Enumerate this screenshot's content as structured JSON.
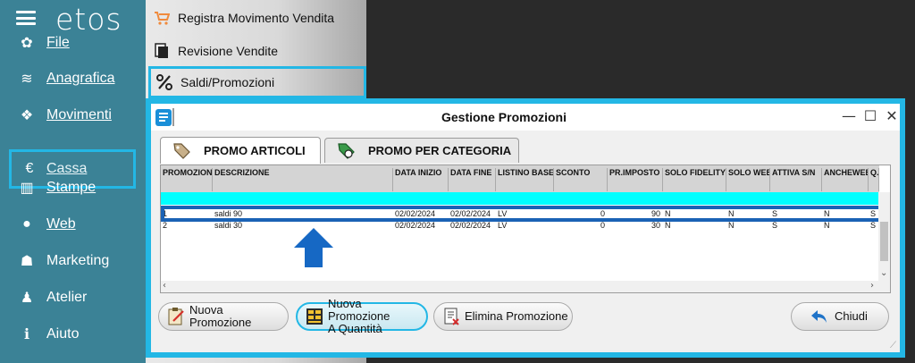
{
  "app": {
    "logo": "etos"
  },
  "sidebar": {
    "items": [
      {
        "icon": "gear-icon",
        "glyph": "✿",
        "label": "File",
        "underline": true
      },
      {
        "icon": "database-icon",
        "glyph": "≋",
        "label": "Anagrafica",
        "underline": true
      },
      {
        "icon": "cubes-icon",
        "glyph": "❖",
        "label": "Movimenti",
        "underline": true
      },
      {
        "icon": "euro-icon",
        "glyph": "€",
        "label": "Cassa",
        "underline": true,
        "active": true
      },
      {
        "icon": "bar-chart-icon",
        "glyph": "▥",
        "label": "Stampe",
        "underline": true
      },
      {
        "icon": "globe-icon",
        "glyph": "●",
        "label": "Web",
        "underline": true
      },
      {
        "icon": "users-icon",
        "glyph": "☗",
        "label": "Marketing",
        "underline": false
      },
      {
        "icon": "child-icon",
        "glyph": "♟",
        "label": "Atelier",
        "underline": false
      },
      {
        "icon": "info-icon",
        "glyph": "ℹ",
        "label": "Aiuto",
        "underline": false
      }
    ]
  },
  "menu": {
    "items": [
      {
        "icon": "cart-icon",
        "label": "Registra Movimento Vendita"
      },
      {
        "icon": "document-icon",
        "label": "Revisione Vendite"
      },
      {
        "icon": "percent-icon",
        "label": "Saldi/Promozioni",
        "selected": true
      }
    ]
  },
  "dialog": {
    "title": "Gestione Promozioni",
    "controls": {
      "minimize": "—",
      "maximize": "☐",
      "close": "✕"
    },
    "tabs": [
      {
        "label": "PROMO ARTICOLI",
        "active": true,
        "icon": "tag-icon"
      },
      {
        "label": "PROMO PER CATEGORIA",
        "active": false,
        "icon": "category-tag-icon"
      }
    ],
    "grid": {
      "columns": [
        "PROMOZION",
        "DESCRIZIONE",
        "DATA INIZIO",
        "DATA FINE",
        "LISTINO BASE",
        "SCONTO",
        "PR.IMPOSTO",
        "SOLO FIDELITY",
        "SOLO WEB",
        "ATTIVA S/N",
        "ANCHEWEB",
        "Q. S/"
      ],
      "rows": [
        [
          "1",
          "saldi 90",
          "02/02/2024",
          "02/02/2024",
          "LV",
          "0",
          "90",
          "N",
          "N",
          "S",
          "N",
          "S"
        ],
        [
          "2",
          "saldi 30",
          "02/02/2024",
          "02/02/2024",
          "LV",
          "0",
          "30",
          "N",
          "N",
          "S",
          "N",
          "S"
        ]
      ]
    },
    "buttons": {
      "new_promo": "Nuova Promozione",
      "new_qty_line1": "Nuova Promozione",
      "new_qty_line2": "A Quantità",
      "delete_promo": "Elimina Promozione",
      "close": "Chiudi"
    }
  },
  "colors": {
    "sidebar": "#3b8296",
    "highlight": "#23b7e5",
    "selected_row_border": "#1a62b5",
    "cyan": "#00ffff"
  }
}
